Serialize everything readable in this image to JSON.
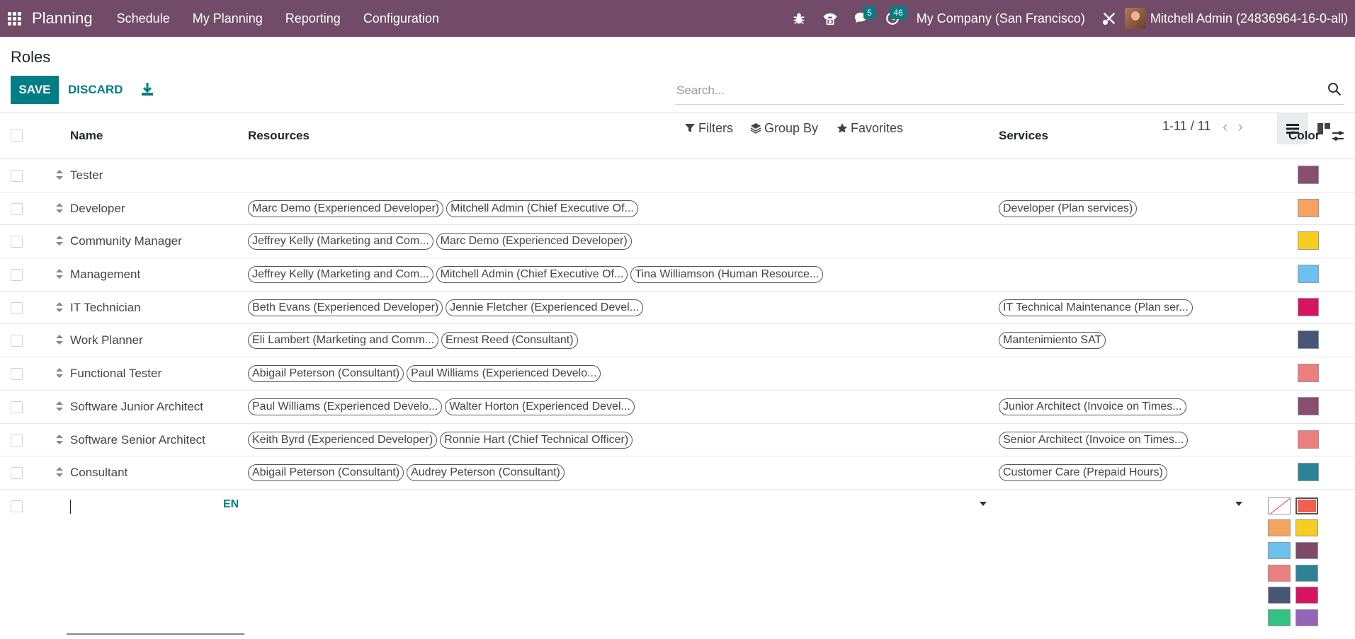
{
  "navbar": {
    "app_name": "Planning",
    "menu": [
      "Schedule",
      "My Planning",
      "Reporting",
      "Configuration"
    ],
    "chat_count": "5",
    "activity_count": "46",
    "company": "My Company (San Francisco)",
    "user": "Mitchell Admin (24836964-16-0-all)"
  },
  "control": {
    "title": "Roles",
    "save": "SAVE",
    "discard": "DISCARD",
    "search_placeholder": "Search...",
    "filters": "Filters",
    "group_by": "Group By",
    "favorites": "Favorites",
    "pager": "1-11 / 11"
  },
  "table": {
    "headers": {
      "name": "Name",
      "resources": "Resources",
      "services": "Services",
      "color": "Color"
    },
    "rows": [
      {
        "name": "Tester",
        "resources": [],
        "services": [],
        "color": "#874e6e"
      },
      {
        "name": "Developer",
        "resources": [
          "Marc Demo (Experienced Developer)",
          "Mitchell Admin (Chief Executive Of..."
        ],
        "services": [
          "Developer (Plan services)"
        ],
        "color": "#f4a460"
      },
      {
        "name": "Community Manager",
        "resources": [
          "Jeffrey Kelly (Marketing and Com...",
          "Marc Demo (Experienced Developer)"
        ],
        "services": [],
        "color": "#f7cd1f"
      },
      {
        "name": "Management",
        "resources": [
          "Jeffrey Kelly (Marketing and Com...",
          "Mitchell Admin (Chief Executive Of...",
          "Tina Williamson (Human Resource..."
        ],
        "services": [],
        "color": "#6cc1ed"
      },
      {
        "name": "IT Technician",
        "resources": [
          "Beth Evans (Experienced Developer)",
          "Jennie Fletcher (Experienced Devel..."
        ],
        "services": [
          "IT Technical Maintenance (Plan ser..."
        ],
        "color": "#d6145f"
      },
      {
        "name": "Work Planner",
        "resources": [
          "Eli Lambert (Marketing and Comm...",
          "Ernest Reed (Consultant)"
        ],
        "services": [
          "Mantenimiento SAT"
        ],
        "color": "#475577"
      },
      {
        "name": "Functional Tester",
        "resources": [
          "Abigail Peterson (Consultant)",
          "Paul Williams (Experienced Develo..."
        ],
        "services": [],
        "color": "#eb7e7f"
      },
      {
        "name": "Software Junior Architect",
        "resources": [
          "Paul Williams (Experienced Develo...",
          "Walter Horton (Experienced Devel..."
        ],
        "services": [
          "Junior Architect (Invoice on Times..."
        ],
        "color": "#874e6e"
      },
      {
        "name": "Software Senior Architect",
        "resources": [
          "Keith Byrd (Experienced Developer)",
          "Ronnie Hart (Chief Technical Officer)"
        ],
        "services": [
          "Senior Architect (Invoice on Times..."
        ],
        "color": "#eb7e7f"
      },
      {
        "name": "Consultant",
        "resources": [
          "Abigail Peterson (Consultant)",
          "Audrey Peterson (Consultant)"
        ],
        "services": [
          "Customer Care (Prepaid Hours)"
        ],
        "color": "#2c8397"
      }
    ],
    "new_row": {
      "lang": "EN"
    },
    "color_picker": [
      "none",
      "#f06050",
      "#f4a460",
      "#f7cd1f",
      "#6cc1ed",
      "#814968",
      "#eb7e7f",
      "#2c8397",
      "#475577",
      "#d6145f",
      "#30c381",
      "#9365b8"
    ],
    "color_picker_selected": 1
  }
}
